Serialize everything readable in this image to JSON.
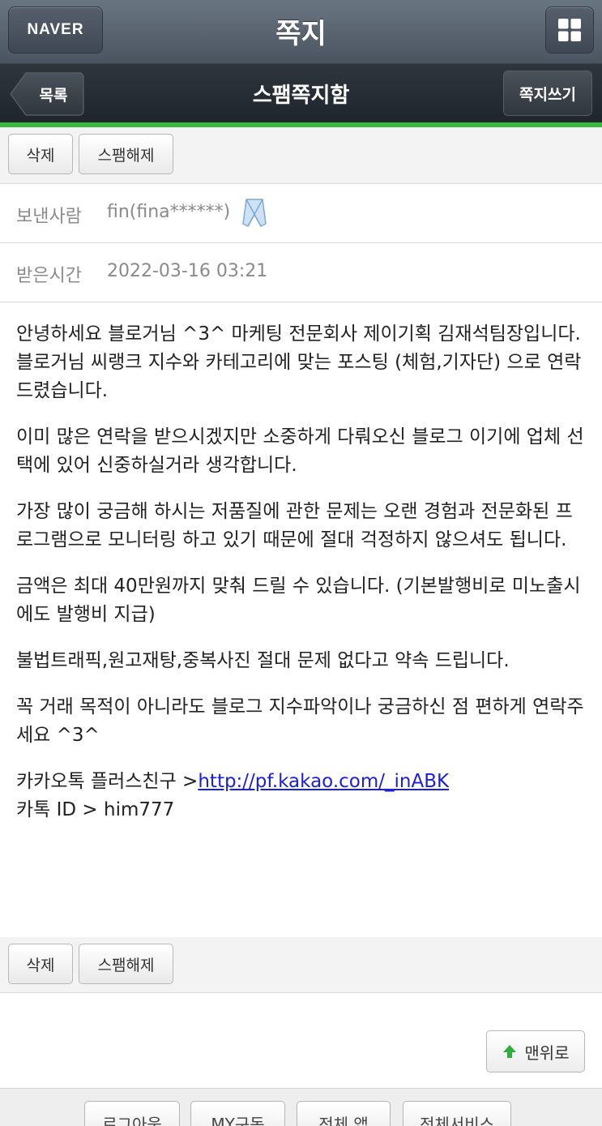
{
  "header": {
    "logo": "NAVER",
    "title": "쪽지",
    "menu_icon": "grid-icon"
  },
  "subheader": {
    "back_label": "목록",
    "title": "스팸쪽지함",
    "write_label": "쪽지쓰기"
  },
  "toolbar": {
    "delete_label": "삭제",
    "unspam_label": "스팸해제"
  },
  "message": {
    "sender_label": "보낸사람",
    "sender_value": "fin(fina******)",
    "received_label": "받은시간",
    "received_value": "2022-03-16 03:21",
    "p1": "안녕하세요 블로거님 ^3^ 마케팅 전문회사 제이기획 김재석팀장입니다.\n블로거님 씨랭크 지수와 카테고리에 맞는 포스팅 (체험,기자단) 으로 연락드렸습니다.",
    "p2": "이미 많은 연락을 받으시겠지만 소중하게 다뤄오신 블로그 이기에 업체 선택에 있어 신중하실거라 생각합니다.",
    "p3": "가장 많이 궁금해 하시는 저품질에 관한 문제는 오랜 경험과 전문화된 프로그램으로 모니터링 하고 있기 때문에 절대 걱정하지 않으셔도 됩니다.",
    "p4": "금액은 최대 40만원까지 맞춰 드릴 수 있습니다. (기본발행비로 미노출시에도 발행비 지급)",
    "p5": "불법트래픽,원고재탕,중복사진 절대 문제 없다고 약속 드립니다.",
    "p6": "꼭 거래 목적이 아니라도 블로그 지수파악이나 궁금하신 점 편하게 연락주세요 ^3^",
    "kakao_prefix": "카카오톡 플러스친구 >",
    "kakao_link": "http://pf.kakao.com/_inABK",
    "kakao_id": "카톡 ID > him777"
  },
  "totop_label": "맨위로",
  "footer": {
    "items": [
      "로그아웃",
      "MY구독",
      "전체 앱",
      "전체서비스"
    ]
  },
  "colors": {
    "accent_green": "#39b93f",
    "link_blue": "#1a1ee0"
  }
}
